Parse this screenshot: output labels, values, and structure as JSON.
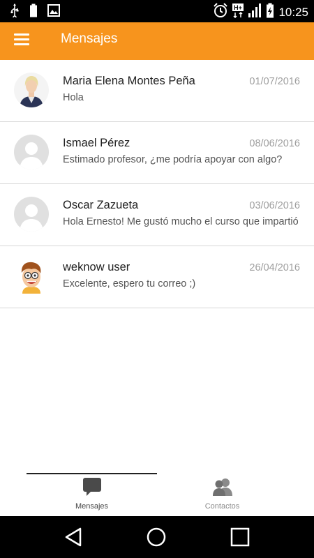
{
  "status_bar": {
    "time": "10:25",
    "icons": [
      "usb-icon",
      "battery-full-icon",
      "image-icon",
      "alarm-icon",
      "hplus-signal-icon",
      "signal-bars-icon",
      "battery-charging-icon"
    ],
    "network_label": "H+"
  },
  "app_bar": {
    "title": "Mensajes",
    "menu_icon": "hamburger-menu-icon",
    "color": "#f7941d"
  },
  "messages": [
    {
      "name": "Maria Elena Montes Peña",
      "date": "01/07/2016",
      "preview": "Hola",
      "avatar": "photo-woman-avatar"
    },
    {
      "name": "Ismael Pérez",
      "date": "08/06/2016",
      "preview": "Estimado profesor, ¿me podría apoyar con algo?",
      "avatar": "default-person-avatar"
    },
    {
      "name": "Oscar Zazueta",
      "date": "03/06/2016",
      "preview": "Hola Ernesto! Me gustó mucho el curso que impartió",
      "avatar": "default-person-avatar"
    },
    {
      "name": "weknow user",
      "date": "26/04/2016",
      "preview": "Excelente, espero tu correo ;)",
      "avatar": "cartoon-man-avatar"
    }
  ],
  "tabs": [
    {
      "label": "Mensajes",
      "icon": "chat-bubble-icon",
      "active": true
    },
    {
      "label": "Contactos",
      "icon": "contacts-icon",
      "active": false
    }
  ],
  "nav_bar": {
    "icons": [
      "back-triangle-icon",
      "home-circle-icon",
      "recents-square-icon"
    ]
  }
}
